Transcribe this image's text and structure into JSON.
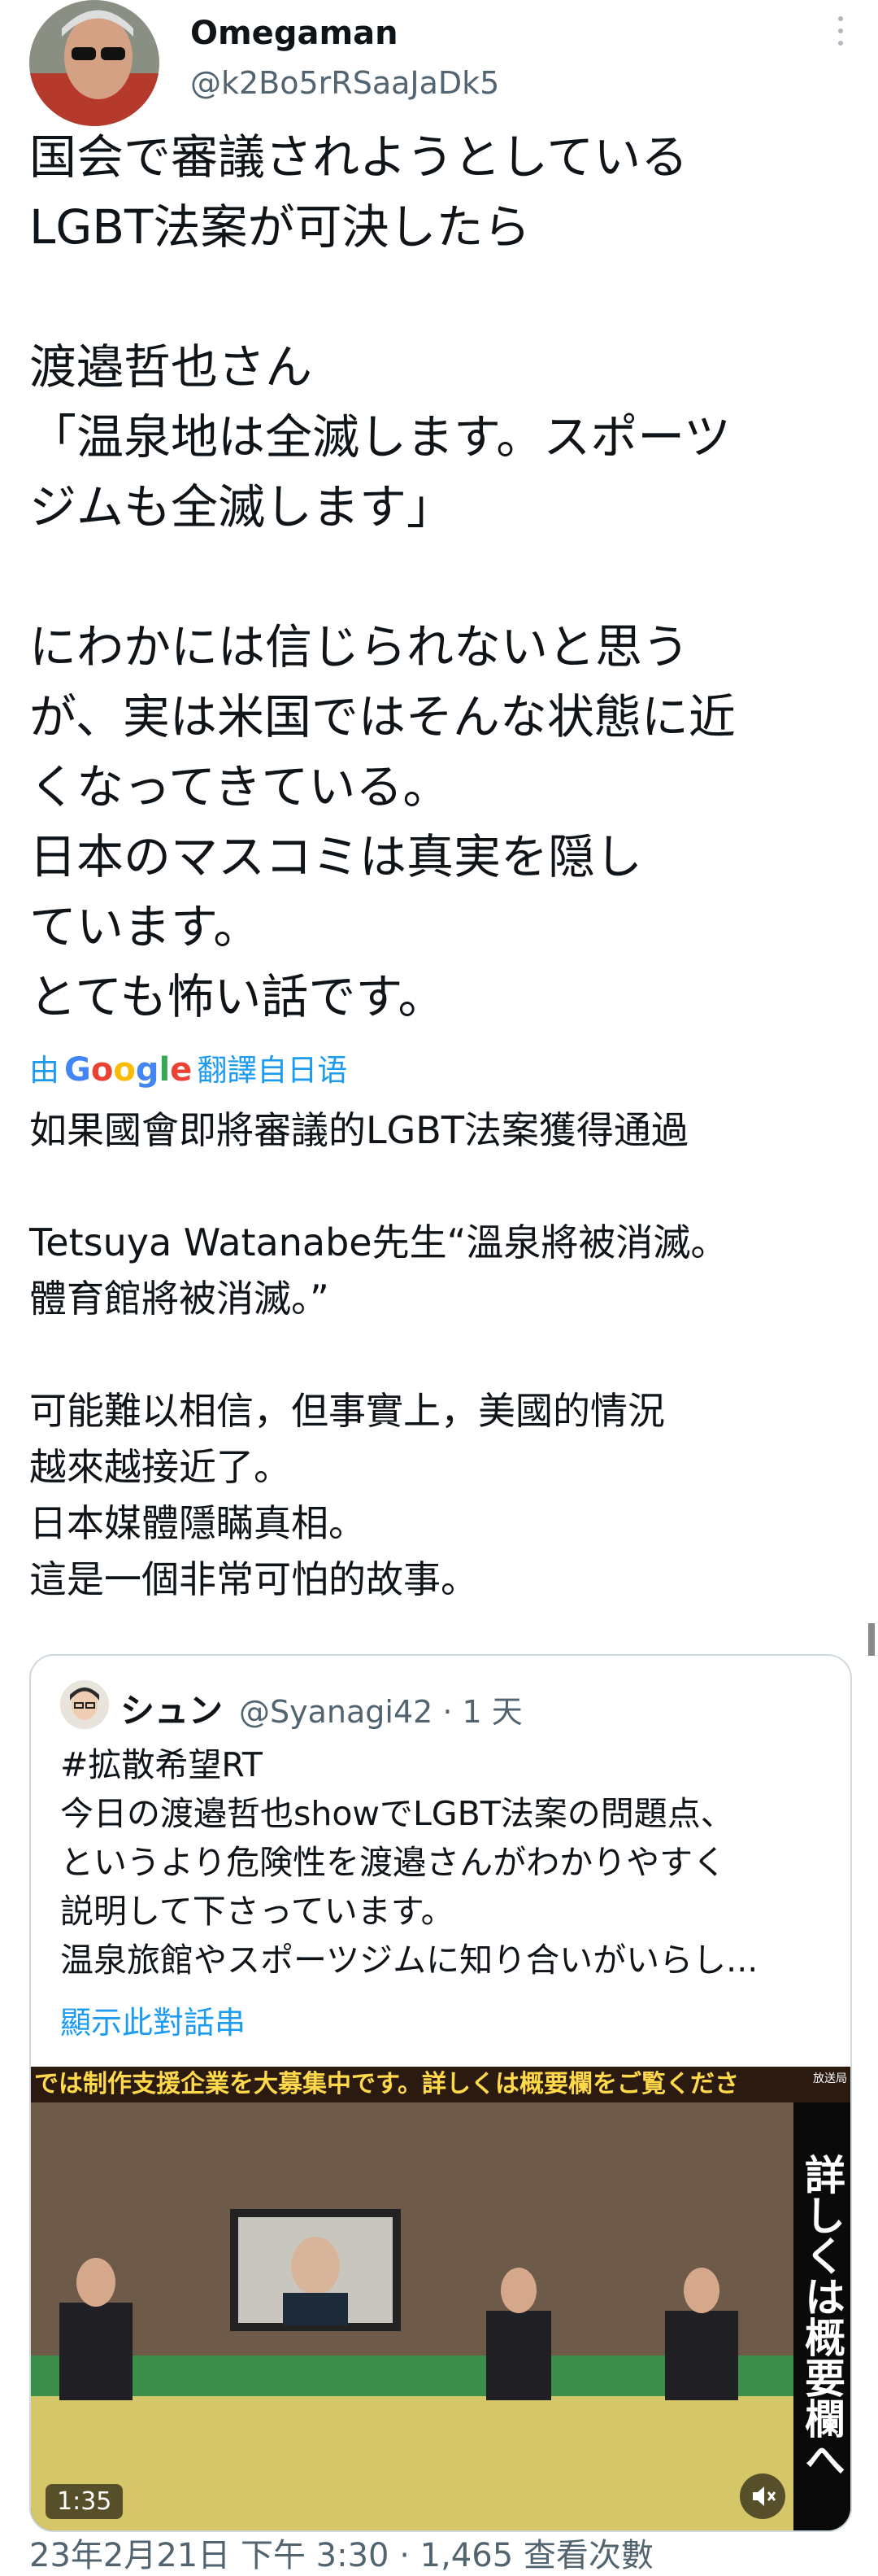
{
  "author": {
    "name": "Omegaman",
    "handle": "@k2Bo5rRSaaJaDk5"
  },
  "tweet": {
    "text": "国会で審議されようとしている\nLGBT法案が可決したら\n\n渡邉哲也さん\n「温泉地は全滅します。スポーツ\nジムも全滅します」\n\nにわかには信じられないと思う\nが、実は米国ではそんな状態に近\nくなってきている。\n日本のマスコミは真実を隠し\nています。\nとても怖い話です。",
    "translated_prefix": "由",
    "translated_brand": "Google",
    "translated_suffix": "翻譯自日语",
    "translation": "如果國會即將審議的LGBT法案獲得通過\n\nTetsuya Watanabe先生“溫泉將被消滅。\n體育館將被消滅。”\n\n可能難以相信，但事實上，美國的情況\n越來越接近了。\n日本媒體隱瞞真相。\n這是一個非常可怕的故事。"
  },
  "quote": {
    "name": "シュン",
    "handle": "@Syanagi42 · 1 天",
    "text": "#拡散希望RT\n今日の渡邉哲也showでLGBT法案の問題点、\nというより危険性を渡邉さんがわかりやすく\n説明して下さっています。\n温泉旅館やスポーツジムに知り合いがいらし...",
    "show_thread": "顯示此對話串",
    "video": {
      "ticker": "では制作支援企業を大募集中です。詳しくは概要欄をご覧くださ",
      "corner_label": "放送局",
      "side_banner": "詳しくは概要欄へ",
      "duration": "1:35"
    }
  },
  "footer": {
    "partial": "23年2月21日 下午 3:30 · 1,465 查看次數"
  }
}
